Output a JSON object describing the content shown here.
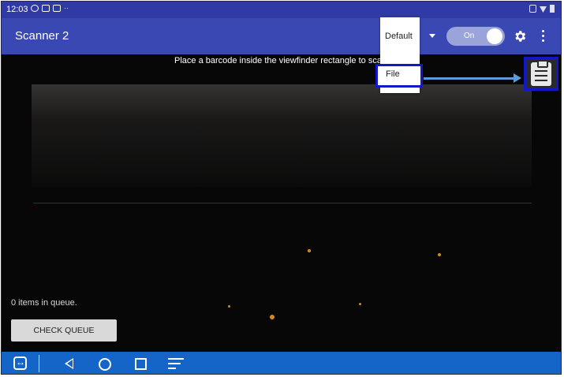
{
  "status_bar": {
    "time": "12:03"
  },
  "app_bar": {
    "title": "Scanner 2",
    "toggle_label": "On"
  },
  "camera": {
    "instruction": "Place a barcode inside the viewfinder rectangle to scan",
    "queue_status": "0 items in queue.",
    "check_queue_label": "CHECK QUEUE"
  },
  "mode_menu": {
    "items": [
      "Default",
      "File"
    ],
    "selected": "File"
  },
  "colors": {
    "app_bar": "#3948b2",
    "status_bar": "#2f3aa5",
    "nav_bar": "#1565c8",
    "highlight": "#1018c8",
    "pointer": "#5a9bd8"
  },
  "icons": [
    "teamviewer-icon",
    "back-icon",
    "home-icon",
    "recents-icon",
    "menu-icon",
    "gear-icon",
    "more-vert-icon",
    "clipboard-icon",
    "dropdown-arrow-icon"
  ]
}
